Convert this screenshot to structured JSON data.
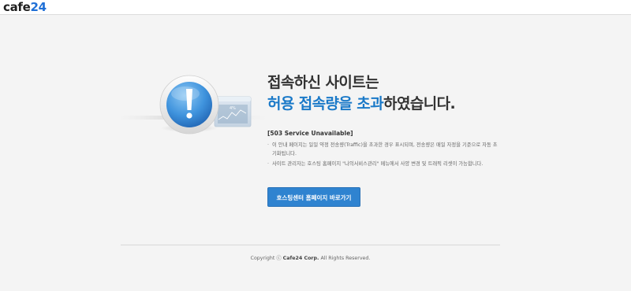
{
  "brand": {
    "logo_prefix": "cafe",
    "logo_number": "24"
  },
  "main": {
    "headline_line1": "접속하신 사이트는",
    "headline_highlight": "허용 접속량을 초과",
    "headline_rest": "하였습니다.",
    "error_title": "[503 Service Unavailable]",
    "notes": [
      "이 안내 페이지는 일일 약정 전송량(Traffic)을 초과한 경우 표시되며, 전송량은 매일 자정을 기준으로 자동 초기화됩니다.",
      "사이트 관리자는 호스팅 홈페이지 \"나의서비스관리\" 메뉴에서 사양 변경 및 트래픽 리셋이 가능합니다."
    ],
    "cta_label": "호스팅센터 홈페이지 바로가기"
  },
  "illustration": {
    "graph_label": "4%"
  },
  "footer": {
    "prefix": "Copyright ⓒ",
    "company": "Cafe24 Corp.",
    "suffix": "All Rights Reserved."
  },
  "colors": {
    "accent": "#1a79c8",
    "button": "#2f83d0",
    "background": "#f4f4f4"
  },
  "icons": {
    "alert": "exclamation-icon",
    "window": "traffic-window-icon"
  }
}
